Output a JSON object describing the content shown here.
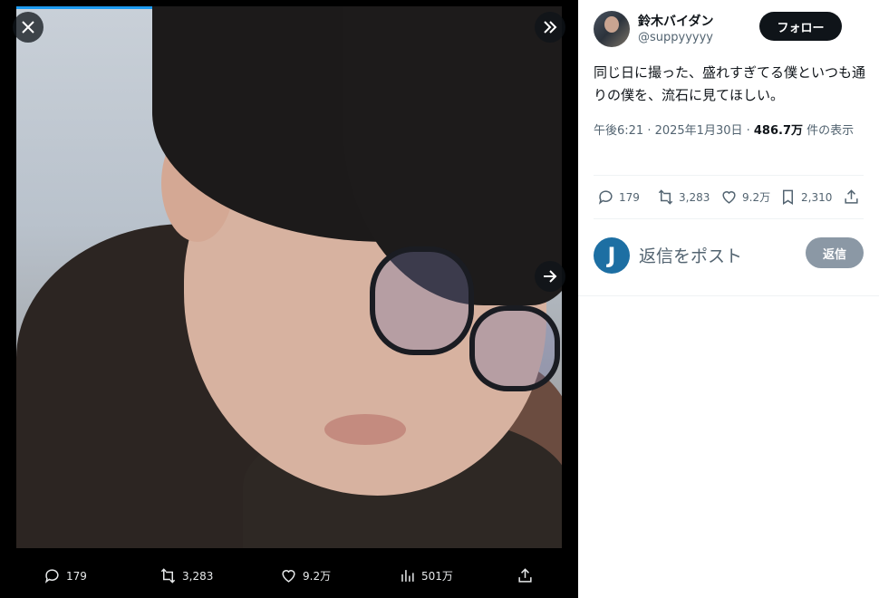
{
  "viewer": {
    "close_icon": "close-icon",
    "expand_icon": "expand-icon",
    "next_icon": "arrow-right-icon",
    "bar": {
      "replies": "179",
      "reposts": "3,283",
      "likes": "9.2万",
      "views": "501万"
    }
  },
  "tweet": {
    "author_name": "鈴木バイダン",
    "author_handle": "@suppyyyyy",
    "follow_label": "フォロー",
    "text": "同じ日に撮った、盛れすぎてる僕といつも通りの僕を、流石に見てほしい。",
    "time": "午後6:21 · 2025年1月30日 · ",
    "view_count": "486.7万",
    "view_suffix": " 件の表示",
    "stats": {
      "replies": "179",
      "reposts": "3,283",
      "likes": "9.2万",
      "bookmarks": "2,310"
    }
  },
  "reply": {
    "avatar_letter": "J",
    "placeholder": "返信をポスト",
    "button_label": "返信"
  }
}
